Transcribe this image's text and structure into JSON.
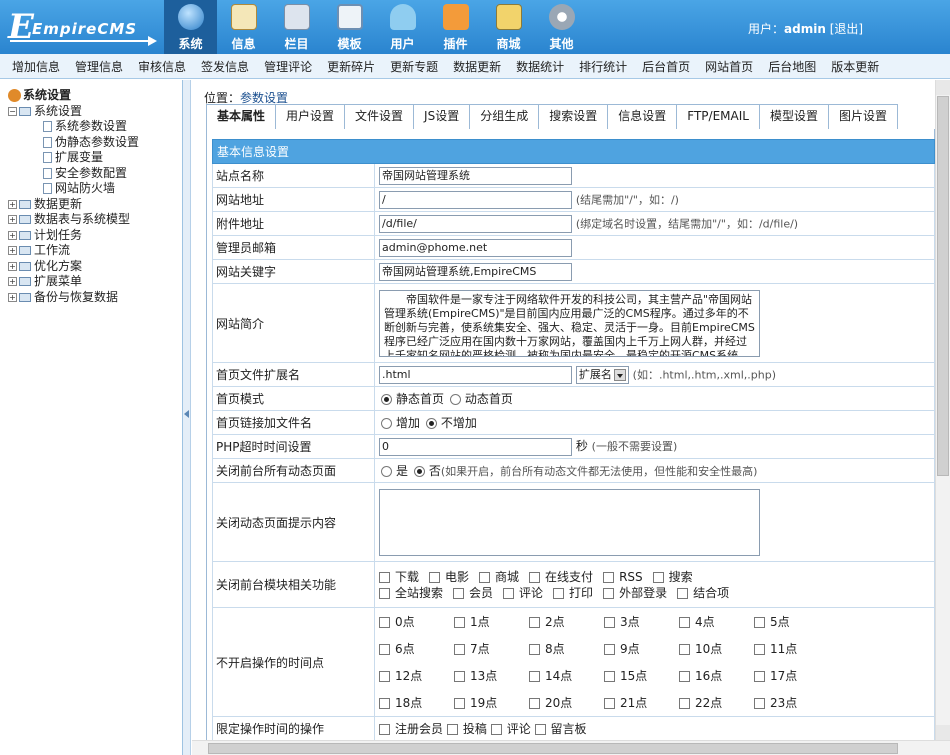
{
  "app": {
    "logo": "EmpireCMS"
  },
  "topnav": [
    {
      "label": "系统",
      "icon": "globe-icon",
      "active": true
    },
    {
      "label": "信息",
      "icon": "notepad-icon"
    },
    {
      "label": "栏目",
      "icon": "folder-icon"
    },
    {
      "label": "模板",
      "icon": "template-icon"
    },
    {
      "label": "用户",
      "icon": "user-icon"
    },
    {
      "label": "插件",
      "icon": "plugin-icon"
    },
    {
      "label": "商城",
      "icon": "shop-icon"
    },
    {
      "label": "其他",
      "icon": "gear-icon"
    }
  ],
  "user": {
    "prefix": "用户：",
    "name": "admin",
    "logout": "[退出]"
  },
  "subnav": [
    "增加信息",
    "管理信息",
    "审核信息",
    "签发信息",
    "管理评论",
    "更新碎片",
    "更新专题",
    "数据更新",
    "数据统计",
    "排行统计",
    "后台首页",
    "网站首页",
    "后台地图",
    "版本更新"
  ],
  "sidebar": {
    "root": "系统设置",
    "group": "系统设置",
    "items": [
      "系统参数设置",
      "伪静态参数设置",
      "扩展变量",
      "安全参数配置",
      "网站防火墙"
    ],
    "others": [
      "数据更新",
      "数据表与系统模型",
      "计划任务",
      "工作流",
      "优化方案",
      "扩展菜单",
      "备份与恢复数据"
    ]
  },
  "crumb": {
    "prefix": "位置：",
    "link": "参数设置"
  },
  "tabs": [
    "基本属性",
    "用户设置",
    "文件设置",
    "JS设置",
    "分组生成",
    "搜索设置",
    "信息设置",
    "FTP/EMAIL",
    "模型设置",
    "图片设置"
  ],
  "form": {
    "section": "基本信息设置",
    "site_name": {
      "label": "站点名称",
      "value": "帝国网站管理系统"
    },
    "site_url": {
      "label": "网站地址",
      "value": "/",
      "hint": "(结尾需加\"/\"，如：/)"
    },
    "attach_url": {
      "label": "附件地址",
      "value": "/d/file/",
      "hint": "(绑定域名时设置，结尾需加\"/\"，如：/d/file/)"
    },
    "email": {
      "label": "管理员邮箱",
      "value": "admin@phome.net"
    },
    "keywords": {
      "label": "网站关键字",
      "value": "帝国网站管理系统,EmpireCMS"
    },
    "intro": {
      "label": "网站简介",
      "value": "帝国软件是一家专注于网络软件开发的科技公司，其主营产品\"帝国网站管理系统(EmpireCMS)\"是目前国内应用最广泛的CMS程序。通过多年的不断创新与完善，使系统集安全、强大、稳定、灵活于一身。目前EmpireCMS程序已经广泛应用在国内数十万家网站，覆盖国内上千万上网人群，并经过上千家知名网站的严格检测，被称为国内最安全、最稳定的开源CMS系统。"
    },
    "ext": {
      "label": "首页文件扩展名",
      "value": ".html",
      "select": "扩展名",
      "hint": "(如：.html,.htm,.xml,.php)"
    },
    "mode": {
      "label": "首页模式",
      "opt1": "静态首页",
      "opt2": "动态首页"
    },
    "append": {
      "label": "首页链接加文件名",
      "opt1": "增加",
      "opt2": "不增加"
    },
    "timeout": {
      "label": "PHP超时时间设置",
      "value": "0",
      "unit": "秒",
      "hint": "(一般不需要设置)"
    },
    "close_dynamic": {
      "label": "关闭前台所有动态页面",
      "opt1": "是",
      "opt2": "否",
      "hint": "(如果开启，前台所有动态文件都无法使用，但性能和安全性最高)"
    },
    "close_tip": {
      "label": "关闭动态页面提示内容"
    },
    "close_modules": {
      "label": "关闭前台模块相关功能",
      "items": [
        "下载",
        "电影",
        "商城",
        "在线支付",
        "RSS",
        "搜索",
        "全站搜索",
        "会员",
        "评论",
        "打印",
        "外部登录",
        "结合项"
      ]
    },
    "hours": {
      "label": "不开启操作的时间点",
      "items": [
        "0点",
        "1点",
        "2点",
        "3点",
        "4点",
        "5点",
        "6点",
        "7点",
        "8点",
        "9点",
        "10点",
        "11点",
        "12点",
        "13点",
        "14点",
        "15点",
        "16点",
        "17点",
        "18点",
        "19点",
        "20点",
        "21点",
        "22点",
        "23点"
      ]
    },
    "last_row": {
      "label": "限定操作时间的操作",
      "items": [
        "注册会员",
        "投稿",
        "评论",
        "留言板"
      ]
    }
  }
}
